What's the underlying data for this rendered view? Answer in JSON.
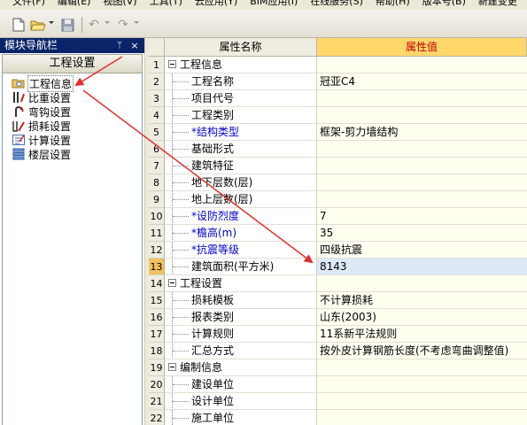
{
  "menu": {
    "items": [
      "文件(F)",
      "编辑(E)",
      "视图(V)",
      "工具(T)",
      "云应用(Y)",
      "BIM应用(I)",
      "在线服务(S)",
      "帮助(H)",
      "版本号(B)",
      "新建变更"
    ]
  },
  "toolbar": {
    "buttons": [
      "new-file-icon",
      "open-folder-icon",
      "save-icon",
      "undo-icon",
      "redo-icon"
    ]
  },
  "left_panel": {
    "title": "模块导航栏",
    "pin": "ᛘ",
    "close": "×",
    "header": "工程设置",
    "items": [
      {
        "label": "工程信息",
        "icon": "folder-info-icon",
        "selected": true
      },
      {
        "label": "比重设置",
        "icon": "rebar-weight-icon"
      },
      {
        "label": "弯钩设置",
        "icon": "hook-icon"
      },
      {
        "label": "损耗设置",
        "icon": "loss-icon"
      },
      {
        "label": "计算设置",
        "icon": "calc-settings-icon"
      },
      {
        "label": "楼层设置",
        "icon": "floor-settings-icon"
      }
    ]
  },
  "grid": {
    "col_name": "属性名称",
    "col_value": "属性值",
    "rows": [
      {
        "num": "1",
        "type": "group",
        "name": "工程信息",
        "value": ""
      },
      {
        "num": "2",
        "type": "child",
        "name": "工程名称",
        "value": "冠亚C4"
      },
      {
        "num": "3",
        "type": "child",
        "name": "项目代号",
        "value": ""
      },
      {
        "num": "4",
        "type": "child",
        "name": "工程类别",
        "value": ""
      },
      {
        "num": "5",
        "type": "child",
        "blue": true,
        "name": "结构类型",
        "value": "框架-剪力墙结构"
      },
      {
        "num": "6",
        "type": "child",
        "name": "基础形式",
        "value": ""
      },
      {
        "num": "7",
        "type": "child",
        "name": "建筑特征",
        "value": ""
      },
      {
        "num": "8",
        "type": "child",
        "name": "地下层数(层)",
        "value": ""
      },
      {
        "num": "9",
        "type": "child",
        "name": "地上层数(层)",
        "value": ""
      },
      {
        "num": "10",
        "type": "child",
        "blue": true,
        "name": "设防烈度",
        "value": "7"
      },
      {
        "num": "11",
        "type": "child",
        "blue": true,
        "name": "檐高(m)",
        "value": "35"
      },
      {
        "num": "12",
        "type": "child",
        "blue": true,
        "name": "抗震等级",
        "value": "四级抗震"
      },
      {
        "num": "13",
        "type": "child",
        "name": "建筑面积(平方米)",
        "value": "8143",
        "active": true
      },
      {
        "num": "14",
        "type": "group",
        "name": "工程设置",
        "value": ""
      },
      {
        "num": "15",
        "type": "child",
        "name": "损耗模板",
        "value": "不计算损耗"
      },
      {
        "num": "16",
        "type": "child",
        "name": "报表类别",
        "value": "山东(2003)"
      },
      {
        "num": "17",
        "type": "child",
        "name": "计算规则",
        "value": "11系新平法规则"
      },
      {
        "num": "18",
        "type": "child",
        "name": "汇总方式",
        "value": "按外皮计算钢筋长度(不考虑弯曲调整值)"
      },
      {
        "num": "19",
        "type": "group",
        "name": "编制信息",
        "value": ""
      },
      {
        "num": "20",
        "type": "child",
        "name": "建设单位",
        "value": ""
      },
      {
        "num": "21",
        "type": "child",
        "name": "设计单位",
        "value": ""
      },
      {
        "num": "22",
        "type": "child",
        "name": "施工单位",
        "value": ""
      }
    ]
  },
  "colors": {
    "annotation_arrow": "#e03030",
    "title_bar": "#0a246a",
    "value_header": "#ffd76a",
    "active_row": "#dde9f7"
  }
}
